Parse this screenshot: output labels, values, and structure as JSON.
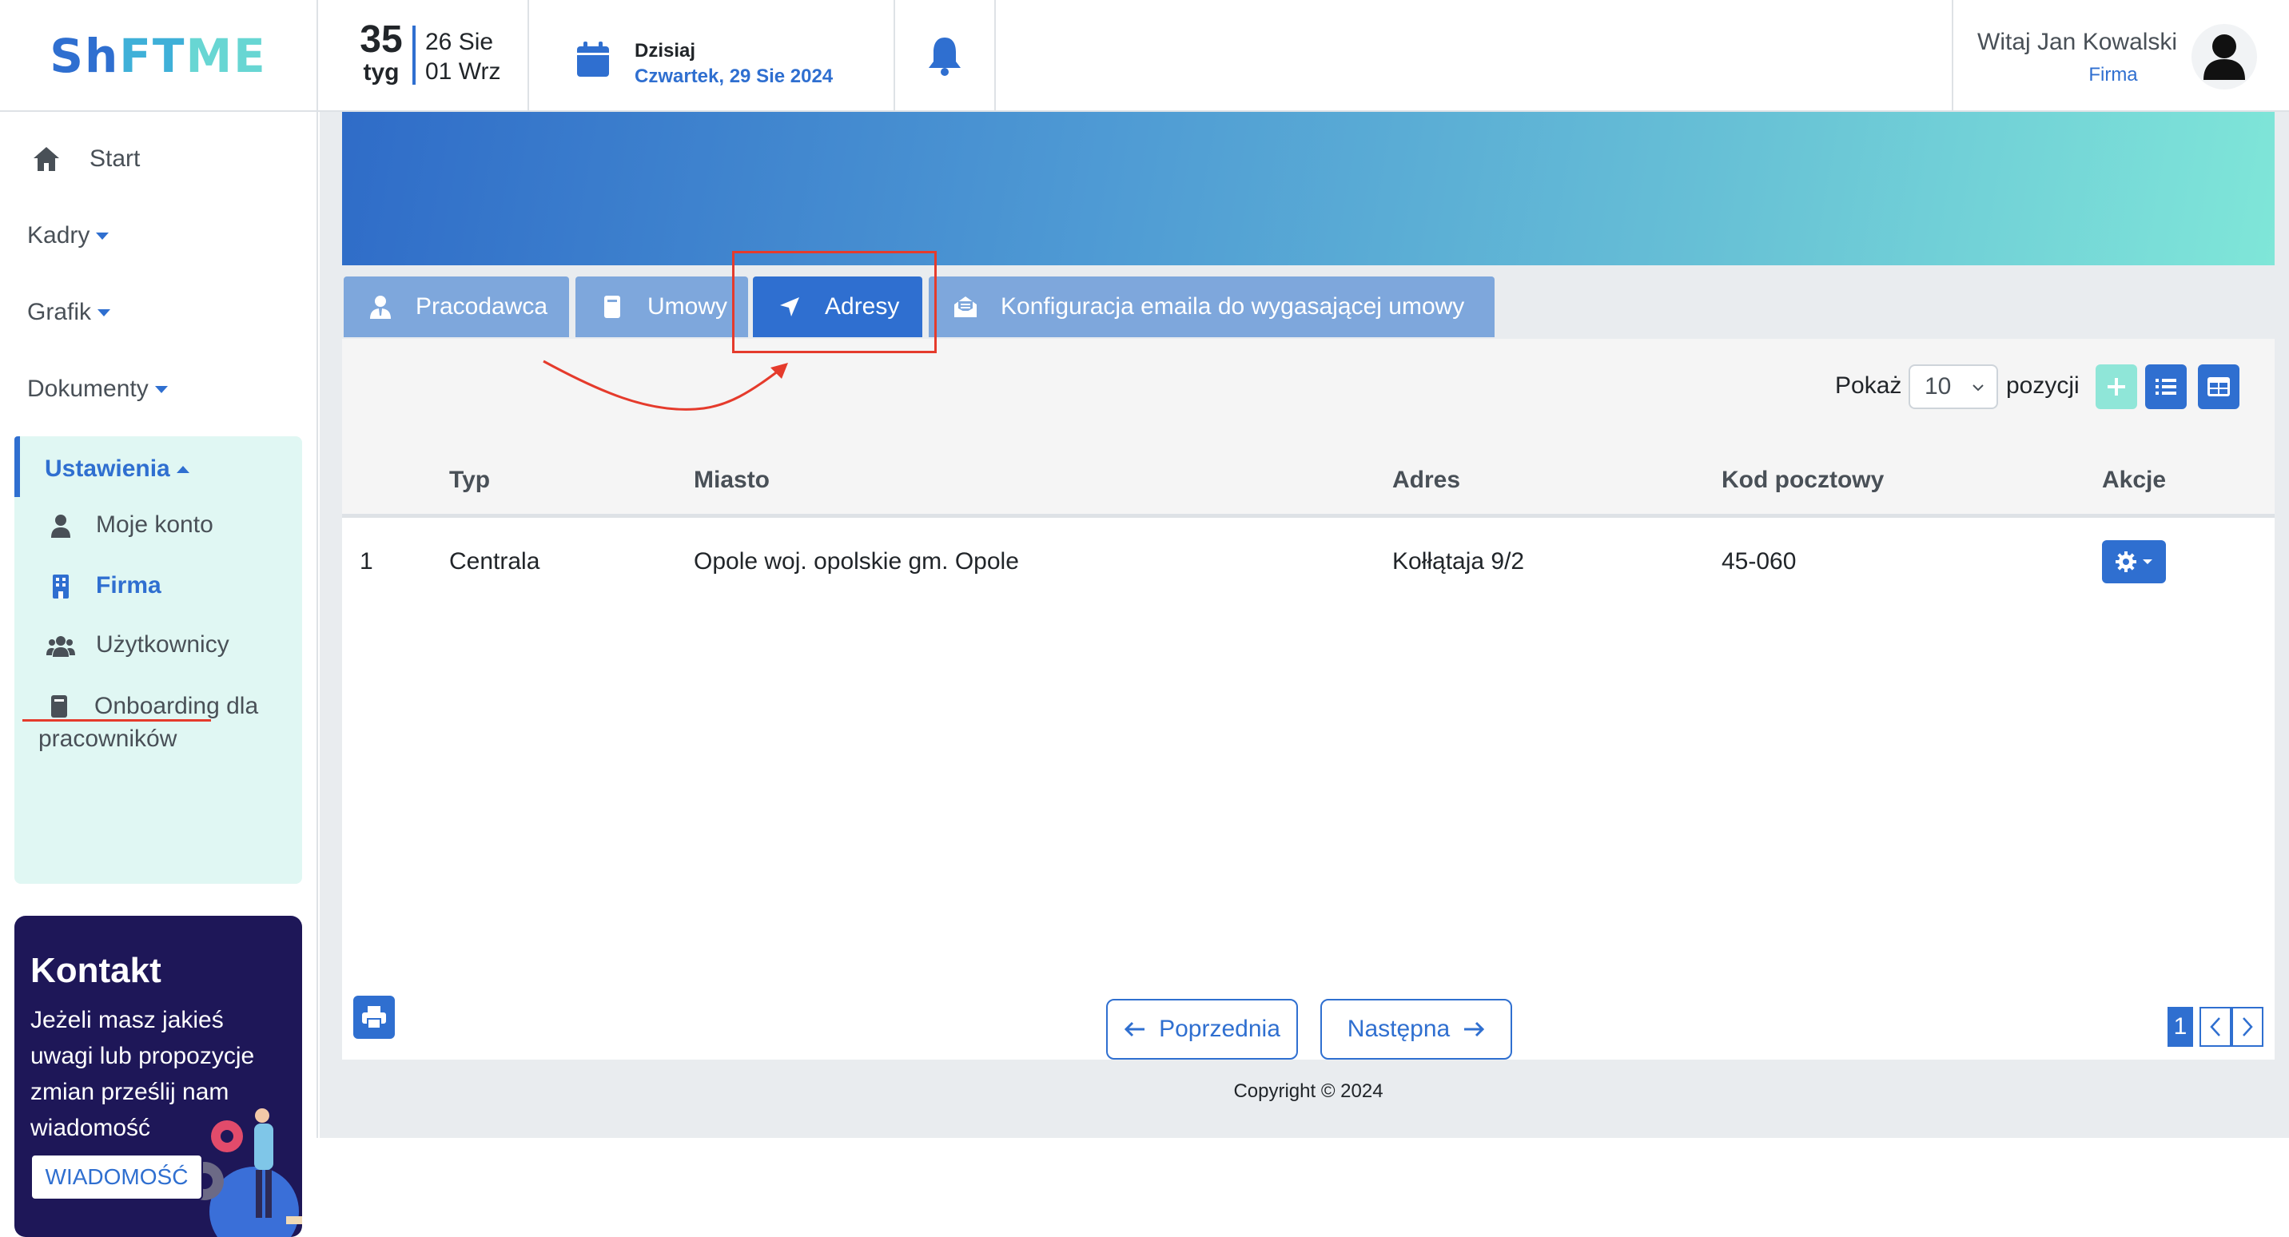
{
  "logo": {
    "part1": "S",
    "part2": "h",
    "part3": "FT",
    "part4": "ME"
  },
  "week": {
    "number": "35",
    "label": "tyg",
    "start": "26 Sie",
    "end": "01 Wrz"
  },
  "today": {
    "label": "Dzisiaj",
    "date": "Czwartek, 29 Sie 2024"
  },
  "user": {
    "greeting": "Witaj Jan Kowalski",
    "role": "Firma"
  },
  "sidebar": {
    "start": "Start",
    "kadry": "Kadry",
    "grafik": "Grafik",
    "dokumenty": "Dokumenty",
    "ustawienia": "Ustawienia",
    "moje_konto": "Moje konto",
    "firma": "Firma",
    "uzytkownicy": "Użytkownicy",
    "onboarding_line1": "Onboarding dla",
    "onboarding_line2": "pracowników"
  },
  "contact": {
    "title": "Kontakt",
    "text": "Jeżeli masz jakieś uwagi lub propozycje zmian prześlij nam wiadomość",
    "button": "WIADOMOŚĆ"
  },
  "tabs": [
    {
      "label": "Pracodawca"
    },
    {
      "label": "Umowy"
    },
    {
      "label": "Adresy"
    },
    {
      "label": "Konfiguracja emaila do wygasającej umowy"
    }
  ],
  "toolbar": {
    "show_label": "Pokaż",
    "page_size": "10",
    "positions_label": "pozycji"
  },
  "table": {
    "headers": [
      "Typ",
      "Miasto",
      "Adres",
      "Kod pocztowy",
      "Akcje"
    ],
    "rows": [
      {
        "index": "1",
        "typ": "Centrala",
        "miasto": "Opole woj. opolskie gm. Opole",
        "adres": "Kołłątaja 9/2",
        "kod": "45-060"
      }
    ]
  },
  "pagination": {
    "prev": "Poprzednia",
    "next": "Następna",
    "current": "1"
  },
  "footer": {
    "copyright": "Copyright © 2024"
  },
  "colors": {
    "primary": "#2f6fd0",
    "tab_inactive": "#7ea7dc",
    "annotation": "#e53b2c",
    "sidebar_highlight": "#e0f7f3"
  }
}
